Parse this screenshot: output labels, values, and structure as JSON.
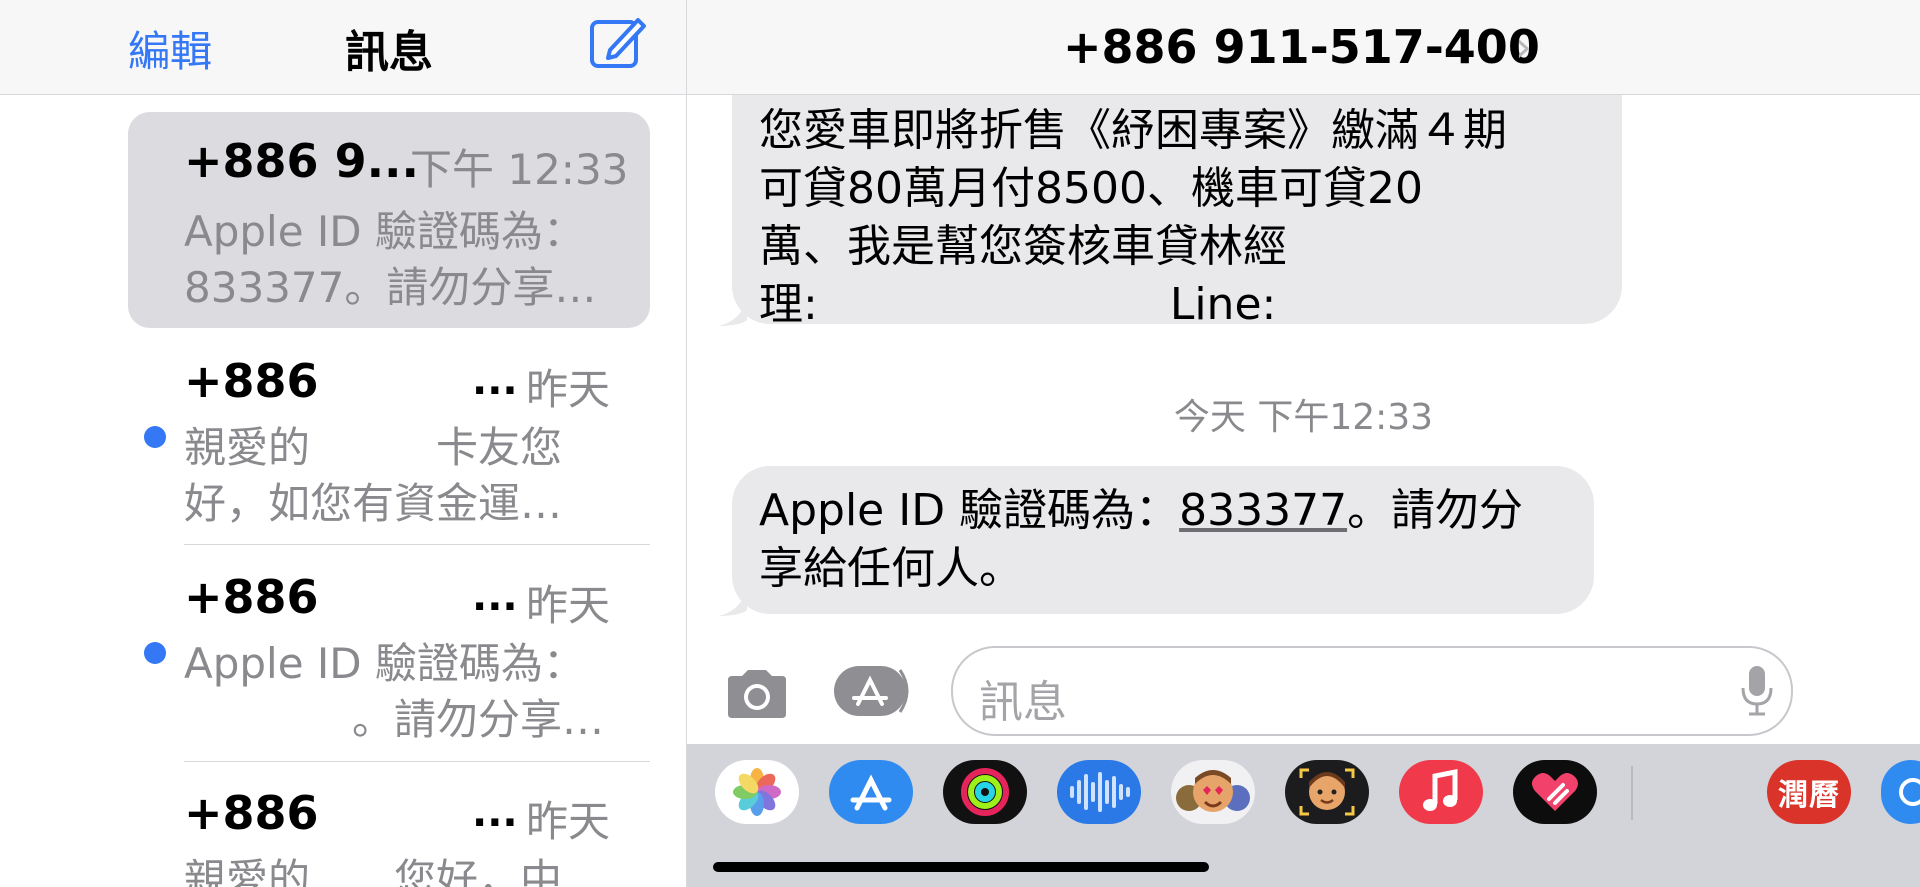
{
  "left_pane": {
    "edit_label": "編輯",
    "title": "訊息",
    "compose_icon": "compose-icon",
    "conversations": [
      {
        "name": "+886 9...",
        "time": "下午 12:33",
        "ellipsis": "",
        "line1": "Apple ID 驗證碼為：",
        "line2": "833377。請勿分享…",
        "unread": false,
        "selected": true
      },
      {
        "name": "+886",
        "time": "昨天",
        "ellipsis": "...",
        "line1": "親愛的　　　卡友您",
        "line2": "好，如您有資金運…",
        "unread": true,
        "selected": false
      },
      {
        "name": "+886",
        "time": "昨天",
        "ellipsis": "...",
        "line1": "Apple ID 驗證碼為：",
        "line2": "　　　　。請勿分享…",
        "unread": true,
        "selected": false
      },
      {
        "name": "+886",
        "time": "昨天",
        "ellipsis": "...",
        "line1": "親愛的　　您好，中",
        "line2": "",
        "unread": false,
        "selected": false
      }
    ]
  },
  "conversation": {
    "contact": "+886 911-517-400",
    "chevron": "›",
    "message1_lines": [
      "您愛車即將折售《紓困專案》繳滿４期",
      "可貸80萬月付8500、機車可貸20",
      "萬、我是幫您簽核車貸林經",
      "理:　　　　　　　　Line:"
    ],
    "timestamp": "今天 下午12:33",
    "message2": {
      "line1_prefix": "Apple ID 驗證碼為：",
      "code": "833377",
      "line1_suffix": "。請勿分",
      "line2": "享給任何人。"
    },
    "input_placeholder": "訊息"
  },
  "app_drawer": {
    "apps": [
      "photos-icon",
      "app-store-icon",
      "activity-icon",
      "soundhound-icon",
      "memoji-stickers-icon",
      "memoji-icon",
      "music-icon",
      "digital-touch-icon",
      "almanac-app-icon",
      "more-apps-icon"
    ],
    "almanac_label": "潤曆"
  },
  "colors": {
    "accent": "#3478f6",
    "bubble": "#e9e9eb",
    "selected_row": "#dcdce0",
    "secondary_text": "#8a8a8e"
  }
}
